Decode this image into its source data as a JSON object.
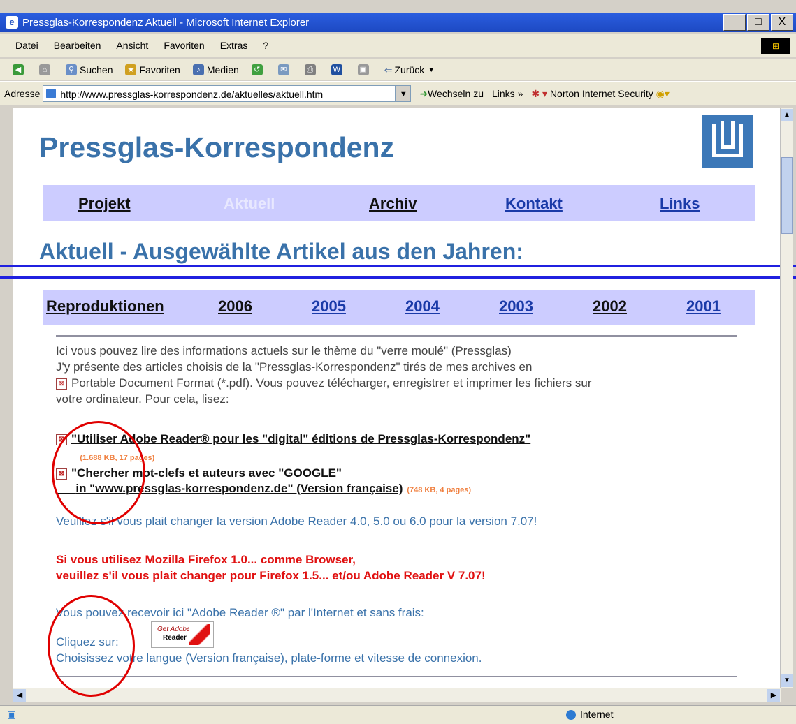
{
  "window": {
    "title": "Pressglas-Korrespondenz Aktuell - Microsoft Internet Explorer",
    "controls": [
      "_",
      "□",
      "X"
    ]
  },
  "menu": [
    "Datei",
    "Bearbeiten",
    "Ansicht",
    "Favoriten",
    "Extras",
    "?"
  ],
  "toolbar": {
    "search": "Suchen",
    "favorites": "Favoriten",
    "media": "Medien",
    "back": "Zurück"
  },
  "address": {
    "label": "Adresse",
    "url": "http://www.pressglas-korrespondenz.de/aktuelles/aktuell.htm",
    "go": "Wechseln zu",
    "links": "Links",
    "norton": "Norton Internet Security"
  },
  "site": {
    "title": "Pressglas-Korrespondenz",
    "nav": [
      "Projekt",
      "Aktuell",
      "Archiv",
      "Kontakt",
      "Links"
    ],
    "heading": "Aktuell - Ausgewählte Artikel aus den Jahren:",
    "years": [
      "Reproduktionen",
      "2006",
      "2005",
      "2004",
      "2003",
      "2002",
      "2001"
    ]
  },
  "intro": {
    "line1": "Ici vous pouvez lire des informations actuels sur le thème du \"verre moulé\" (Pressglas)",
    "line2": "J'y présente des articles choisis de la \"Pressglas-Korrespondenz\" tirés de mes archives en",
    "line3": "Portable Document Format (*.pdf). Vous pouvez télécharger, enregistrer et imprimer les fichiers sur",
    "line4": "votre ordinateur. Pour cela, lisez:"
  },
  "docs": {
    "doc1_title": "\"Utiliser Adobe Reader® pour les \"digital\" éditions de Pressglas-Korrespondenz\"",
    "doc1_size": "(1.688 KB, 17 pages)",
    "doc2_title_line1": "\"Chercher mot-clefs et auteurs avec \"GOOGLE\"",
    "doc2_title_line2": "in \"www.pressglas-korrespondenz.de\" (Version française)",
    "doc2_size": "(748 KB, 4 pages)"
  },
  "notes": {
    "version": "Veuillez s'il vous plait changer la version Adobe Reader 4.0, 5.0 ou 6.0 pour la version 7.07!",
    "firefox1": "Si vous utilisez Mozilla Firefox 1.0... comme Browser,",
    "firefox2": "veuillez s'il vous plait changer pour Firefox 1.5... et/ou Adobe Reader V 7.07!",
    "receive": "Vous pouvez recevoir ici \"Adobe Reader ®\" par l'Internet et sans frais:",
    "click": "Cliquez sur:",
    "choose": "Choisissez votre langue (Version française), plate-forme et vitesse de connexion."
  },
  "badge": {
    "line1": "Get Adobe",
    "line2": "Reader"
  },
  "status": {
    "zone": "Internet"
  },
  "colors": {
    "nav_bg": "#ccccff",
    "title_blue": "#3a72aa",
    "annotation_red": "#e00000",
    "divider_blue": "#2020e0"
  }
}
